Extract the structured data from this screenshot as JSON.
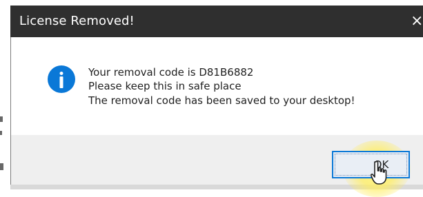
{
  "dialog": {
    "title": "License Removed!",
    "close_glyph": "×",
    "icon": "info-icon",
    "messages": [
      "Your removal code is D81B6882",
      "Please keep this in safe place",
      "The removal code has been saved to your desktop!"
    ],
    "ok_label": "OK"
  },
  "colors": {
    "titlebar": "#2f2f2f",
    "info_icon": "#0a78d7",
    "ok_border": "#0a78d7",
    "footer": "#efefef",
    "highlight": "#fff06a"
  }
}
